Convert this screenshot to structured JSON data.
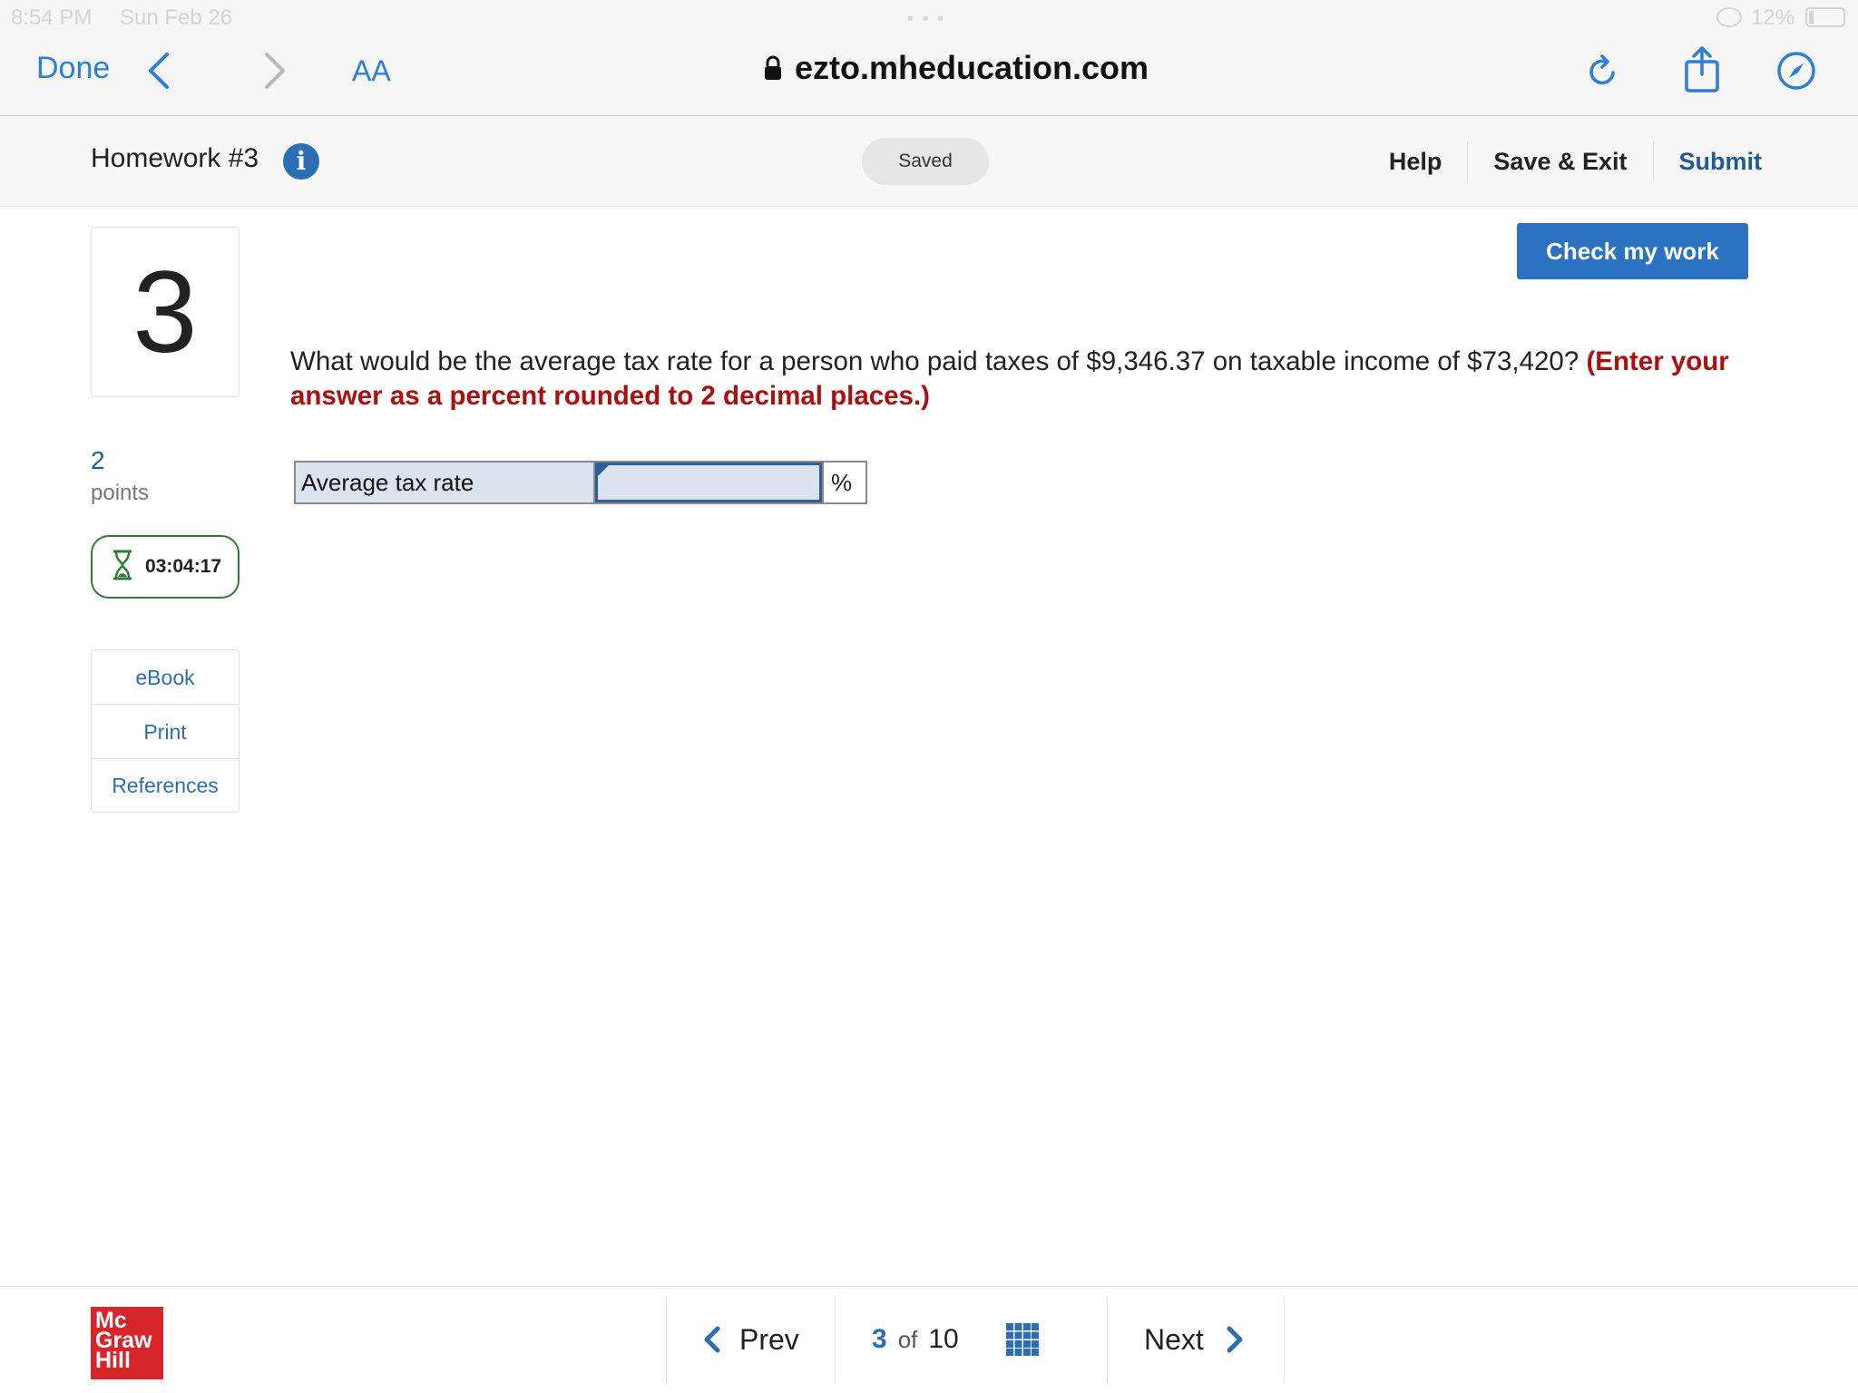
{
  "status_bar": {
    "time": "8:54 PM",
    "date": "Sun Feb 26",
    "battery": "12%"
  },
  "browser": {
    "done_label": "Done",
    "text_size_label": "AA",
    "url": "ezto.mheducation.com"
  },
  "header": {
    "title": "Homework #3",
    "saved_status": "Saved",
    "help_label": "Help",
    "save_exit_label": "Save & Exit",
    "submit_label": "Submit"
  },
  "question": {
    "number": "3",
    "points_value": "2",
    "points_label": "points",
    "timer": "03:04:17",
    "text": "What would be the average tax rate for a person who paid taxes of $9,346.37 on taxable income of $73,420?",
    "instruction": "(Enter your answer as a percent rounded to 2 decimal places.)",
    "answer_label": "Average tax rate",
    "answer_value": "",
    "answer_unit": "%"
  },
  "tools": {
    "ebook": "eBook",
    "print": "Print",
    "references": "References"
  },
  "check_button": "Check my work",
  "footer": {
    "logo_line1": "Mc",
    "logo_line2": "Graw",
    "logo_line3": "Hill",
    "prev_label": "Prev",
    "current_page": "3",
    "of_label": "of",
    "total_pages": "10",
    "next_label": "Next"
  },
  "colors": {
    "accent": "#2a6fb5",
    "safari_blue": "#2a7de1",
    "instruction_red": "#b00d0d",
    "timer_green": "#2e7d32",
    "button_blue": "#2b73c1",
    "brand_red": "#d9252a"
  }
}
